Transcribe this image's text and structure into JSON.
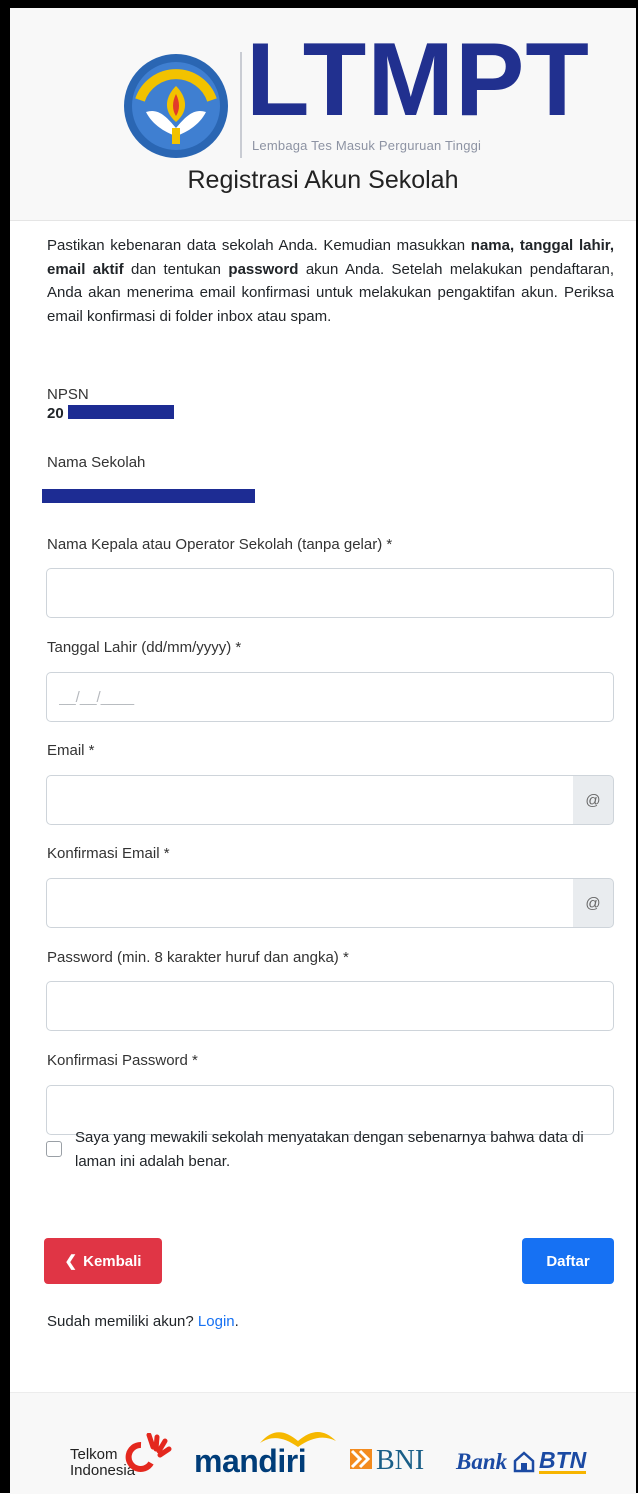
{
  "header": {
    "brand_title": "LTMPT",
    "brand_subtitle": "Lembaga Tes Masuk Perguruan Tinggi",
    "emblem_text": "TUT WURI HANDAYANI",
    "page_title": "Registrasi Akun Sekolah"
  },
  "intro": {
    "t1": "Pastikan kebenaran data sekolah Anda. Kemudian masukkan ",
    "b1": "nama, tanggal lahir, email aktif",
    "t2": " dan tentukan ",
    "b2": "password",
    "t3": " akun Anda. Setelah melakukan pendaftaran, Anda akan menerima email konfirmasi untuk melakukan pengaktifan akun. Periksa email konfirmasi di folder inbox atau spam."
  },
  "npsn": {
    "label": "NPSN",
    "value_visible": "20"
  },
  "school": {
    "label": "Nama Sekolah"
  },
  "fields": {
    "head_name": {
      "label": "Nama Kepala atau Operator Sekolah (tanpa gelar) *",
      "value": ""
    },
    "birth_date": {
      "label": "Tanggal Lahir (dd/mm/yyyy) *",
      "placeholder": "__/__/____"
    },
    "email": {
      "label": "Email *",
      "addon": "@"
    },
    "email_confirm": {
      "label": "Konfirmasi Email *",
      "addon": "@"
    },
    "password": {
      "label": "Password (min. 8 karakter huruf dan angka) *"
    },
    "password_confirm": {
      "label": "Konfirmasi Password *"
    }
  },
  "agreement": {
    "label": "Saya yang mewakili sekolah menyatakan dengan sebenarnya bahwa data di laman ini adalah benar.",
    "checked": false
  },
  "actions": {
    "back_label": "Kembali",
    "submit_label": "Daftar",
    "back_color": "#e03545",
    "submit_color": "#1671f3"
  },
  "login_prompt": {
    "text": "Sudah memiliki akun? ",
    "link": "Login",
    "suffix": "."
  },
  "sponsors": {
    "telkom_line1": "Telkom",
    "telkom_line2": "Indonesia",
    "mandiri": "mandiri",
    "bni": "BNI",
    "btn_bank": "Bank",
    "btn_name": "BTN"
  },
  "colors": {
    "brand_navy": "#21308f",
    "redaction": "#1d2c93"
  }
}
